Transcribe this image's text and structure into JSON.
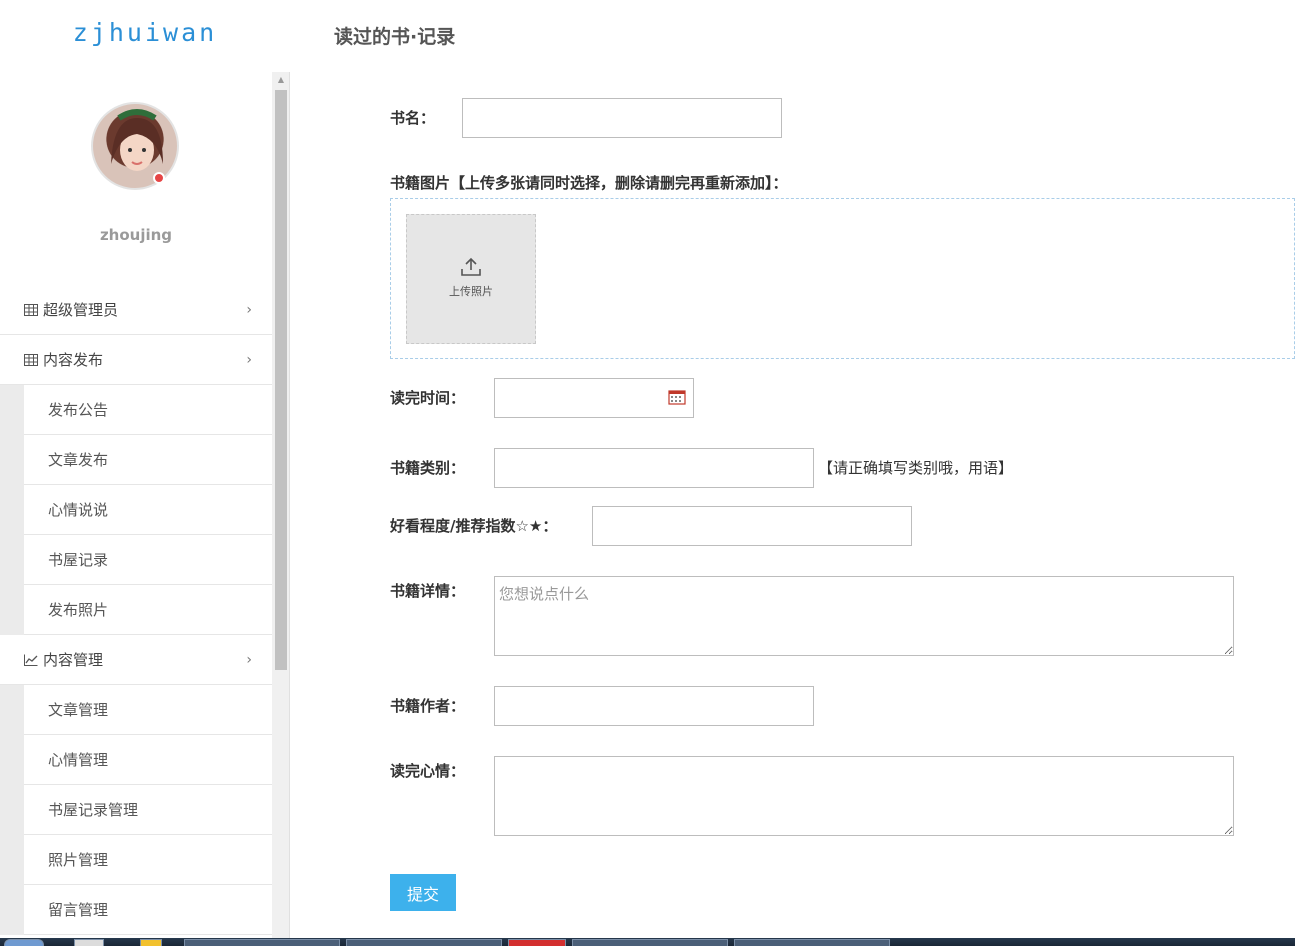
{
  "brand": "zjhuiwan",
  "page_title": "读过的书·记录",
  "user": {
    "name": "zhoujing"
  },
  "menu": {
    "super_admin": "超级管理员",
    "content_publish": {
      "label": "内容发布",
      "items": [
        "发布公告",
        "文章发布",
        "心情说说",
        "书屋记录",
        "发布照片"
      ]
    },
    "content_manage": {
      "label": "内容管理",
      "items": [
        "文章管理",
        "心情管理",
        "书屋记录管理",
        "照片管理",
        "留言管理"
      ]
    }
  },
  "form": {
    "book_name_label": "书名：",
    "book_name_value": "",
    "book_images_label": "书籍图片【上传多张请同时选择，删除请删完再重新添加】：",
    "upload_label": "上传照片",
    "finish_time_label": "读完时间：",
    "finish_time_value": "",
    "category_label": "书籍类别：",
    "category_value": "",
    "category_hint": "【请正确填写类别哦，用语】",
    "rating_label": "好看程度/推荐指数☆★：",
    "rating_value": "",
    "details_label": "书籍详情：",
    "details_placeholder": "您想说点什么",
    "author_label": "书籍作者：",
    "author_value": "",
    "feeling_label": "读完心情：",
    "feeling_value": "",
    "submit_label": "提交"
  },
  "colors": {
    "brand": "#2b8fd6",
    "accent": "#3db1ec",
    "upload_border": "#a9cde8"
  }
}
